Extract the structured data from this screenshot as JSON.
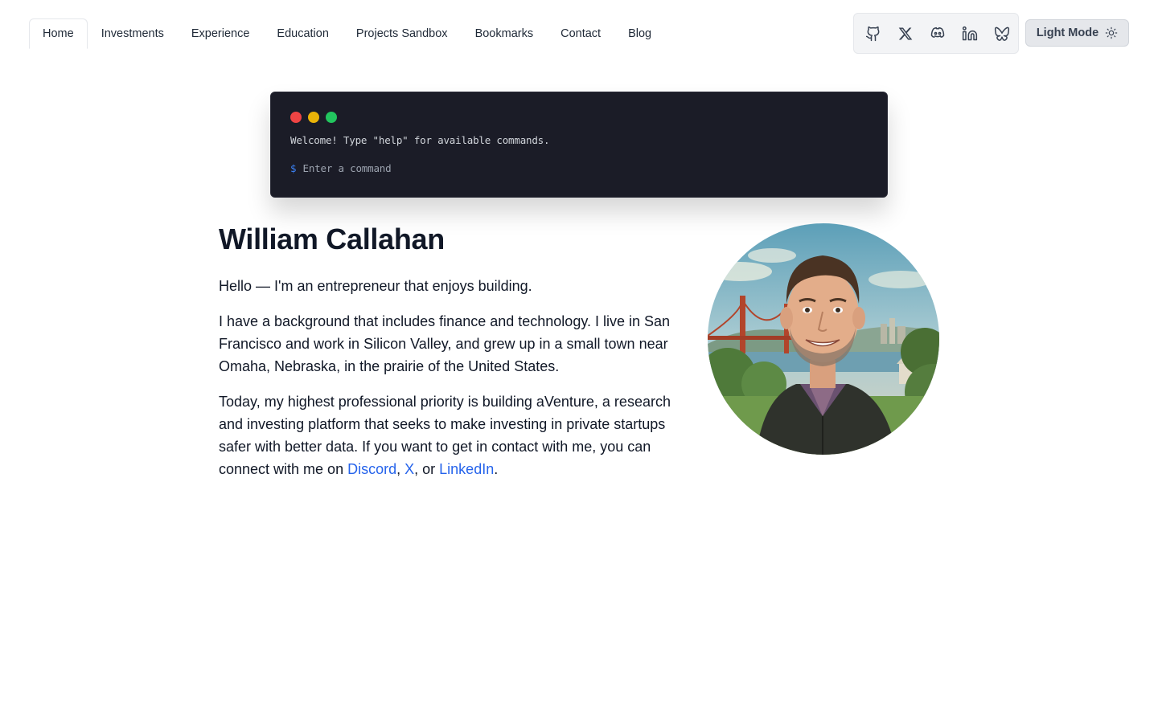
{
  "nav": {
    "items": [
      {
        "label": "Home",
        "active": true
      },
      {
        "label": "Investments"
      },
      {
        "label": "Experience"
      },
      {
        "label": "Education"
      },
      {
        "label": "Projects Sandbox"
      },
      {
        "label": "Bookmarks"
      },
      {
        "label": "Contact"
      },
      {
        "label": "Blog"
      }
    ]
  },
  "social": [
    "github-icon",
    "x-icon",
    "discord-icon",
    "linkedin-icon",
    "bluesky-icon"
  ],
  "theme_toggle": {
    "label": "Light Mode",
    "icon": "sun-icon"
  },
  "terminal": {
    "welcome": "Welcome! Type \"help\" for available commands.",
    "prompt": "$",
    "placeholder": "Enter a command",
    "dot_colors": [
      "#ef4444",
      "#eab308",
      "#22c55e"
    ]
  },
  "intro": {
    "name": "William Callahan",
    "p1": "Hello — I'm an entrepreneur that enjoys building.",
    "p2": "I have a background that includes finance and technology. I live in San Francisco and work in Silicon Valley, and grew up in a small town near Omaha, Nebraska, in the prairie of the United States.",
    "p3_prefix": "Today, my highest professional priority is building aVenture, a research and investing platform that seeks to make investing in private startups safer with better data. If you want to get in contact with me, you can connect with me on ",
    "link_discord": "Discord",
    "sep1": ", ",
    "link_x": "X",
    "sep2": ", or ",
    "link_linkedin": "LinkedIn",
    "p3_suffix": "."
  },
  "colors": {
    "link": "#2563eb",
    "terminal_bg": "#1b1c27",
    "prompt": "#3b82f6"
  }
}
